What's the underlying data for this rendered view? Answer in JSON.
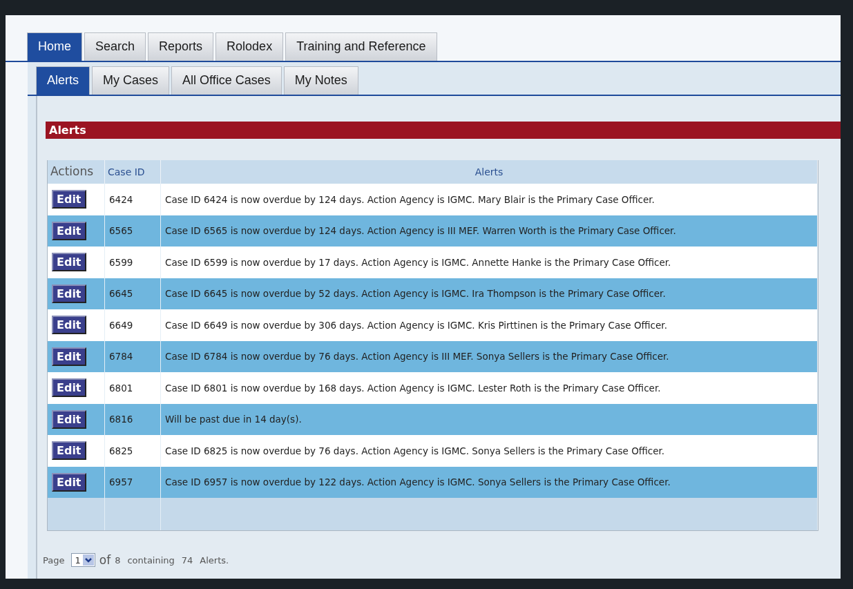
{
  "main_tabs": [
    {
      "label": "Home",
      "selected": true
    },
    {
      "label": "Search",
      "selected": false
    },
    {
      "label": "Reports",
      "selected": false
    },
    {
      "label": "Rolodex",
      "selected": false
    },
    {
      "label": "Training and Reference",
      "selected": false
    }
  ],
  "sub_tabs": [
    {
      "label": "Alerts",
      "selected": true
    },
    {
      "label": "My Cases",
      "selected": false
    },
    {
      "label": "All Office Cases",
      "selected": false
    },
    {
      "label": "My Notes",
      "selected": false
    }
  ],
  "section_title": "Alerts",
  "table": {
    "columns": [
      "Actions",
      "Case ID",
      "Alerts"
    ],
    "rows": [
      {
        "action": "Edit",
        "case_id": "6424",
        "alert": "Case ID 6424 is now overdue by 124 days. Action Agency is IGMC. Mary Blair is the Primary Case Officer."
      },
      {
        "action": "Edit",
        "case_id": "6565",
        "alert": "Case ID 6565 is now overdue by 124 days. Action Agency is III MEF. Warren Worth is the Primary Case Officer."
      },
      {
        "action": "Edit",
        "case_id": "6599",
        "alert": "Case ID 6599 is now overdue by 17 days. Action Agency is IGMC. Annette Hanke is the Primary Case Officer."
      },
      {
        "action": "Edit",
        "case_id": "6645",
        "alert": "Case ID 6645 is now overdue by 52 days. Action Agency is IGMC. Ira Thompson is the Primary Case Officer."
      },
      {
        "action": "Edit",
        "case_id": "6649",
        "alert": "Case ID 6649 is now overdue by 306 days. Action Agency is IGMC. Kris Pirttinen is the Primary Case Officer."
      },
      {
        "action": "Edit",
        "case_id": "6784",
        "alert": "Case ID 6784 is now overdue by 76 days. Action Agency is III MEF. Sonya Sellers is the Primary Case Officer."
      },
      {
        "action": "Edit",
        "case_id": "6801",
        "alert": "Case ID 6801 is now overdue by 168 days. Action Agency is IGMC. Lester Roth is the Primary Case Officer."
      },
      {
        "action": "Edit",
        "case_id": "6816",
        "alert": "Will be past due in 14 day(s)."
      },
      {
        "action": "Edit",
        "case_id": "6825",
        "alert": "Case ID 6825 is now overdue by 76 days. Action Agency is IGMC. Sonya Sellers is the Primary Case Officer."
      },
      {
        "action": "Edit",
        "case_id": "6957",
        "alert": "Case ID 6957 is now overdue by 122 days. Action Agency is IGMC. Sonya Sellers is the Primary Case Officer."
      }
    ]
  },
  "pager": {
    "label": "Page",
    "page": "1",
    "of": "of",
    "total": "8",
    "containing": "containing",
    "count": "74",
    "suffix": "Alerts."
  }
}
